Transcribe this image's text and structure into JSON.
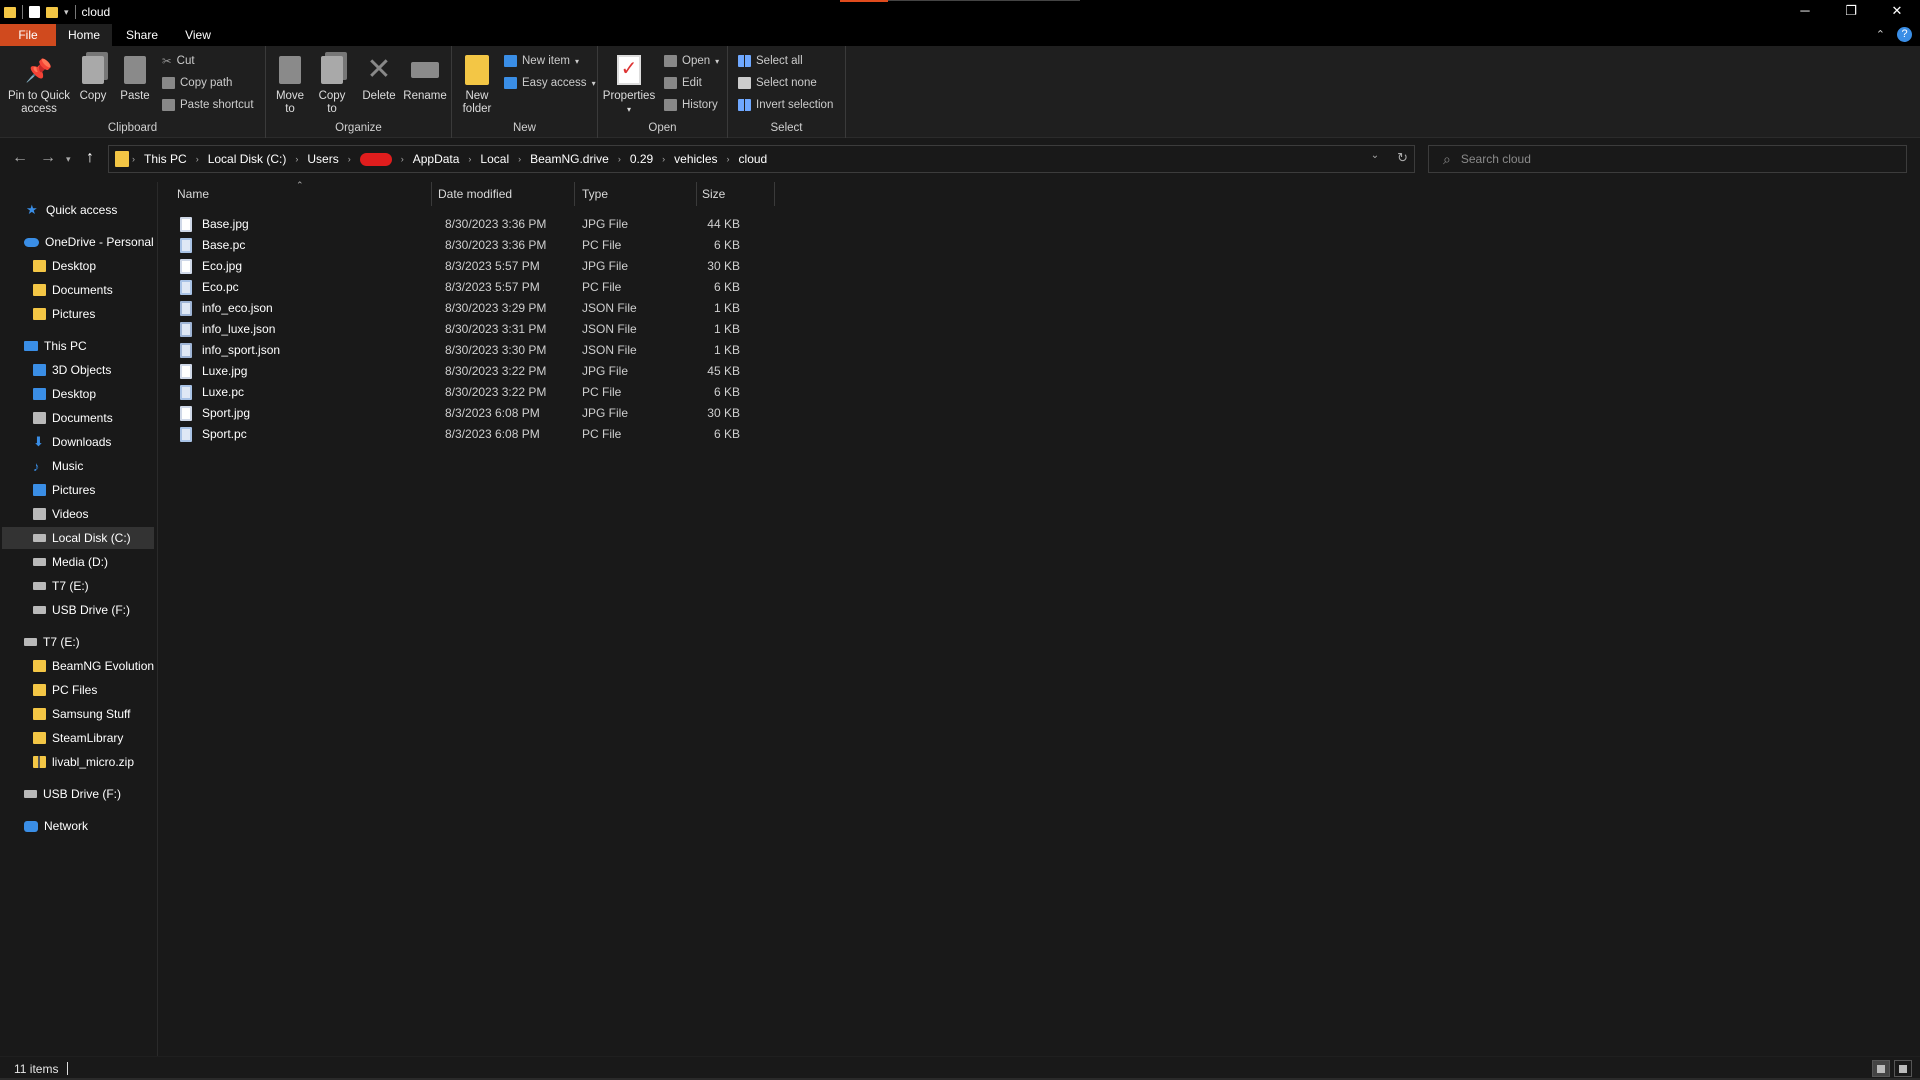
{
  "window": {
    "title": "cloud"
  },
  "tabs": {
    "file": "File",
    "home": "Home",
    "share": "Share",
    "view": "View"
  },
  "ribbon": {
    "clipboard": {
      "label": "Clipboard",
      "pin": "Pin to Quick",
      "pin2": "access",
      "copy": "Copy",
      "paste": "Paste",
      "cut": "Cut",
      "copy_path": "Copy path",
      "paste_shortcut": "Paste shortcut"
    },
    "organize": {
      "label": "Organize",
      "move": "Move",
      "move2": "to",
      "copy": "Copy",
      "copy2": "to",
      "delete": "Delete",
      "rename": "Rename"
    },
    "new": {
      "label": "New",
      "new_folder": "New",
      "new_folder2": "folder",
      "new_item": "New item",
      "easy_access": "Easy access"
    },
    "open": {
      "label": "Open",
      "properties": "Properties",
      "open": "Open",
      "edit": "Edit",
      "history": "History"
    },
    "select": {
      "label": "Select",
      "select_all": "Select all",
      "select_none": "Select none",
      "invert": "Invert selection"
    }
  },
  "address": {
    "crumbs": [
      "This PC",
      "Local Disk (C:)",
      "Users",
      "AppData",
      "Local",
      "BeamNG.drive",
      "0.29",
      "vehicles",
      "cloud"
    ]
  },
  "search": {
    "placeholder": "Search cloud"
  },
  "nav": {
    "quick_access": "Quick access",
    "onedrive": "OneDrive - Personal",
    "od_desktop": "Desktop",
    "od_documents": "Documents",
    "od_pictures": "Pictures",
    "this_pc": "This PC",
    "objects3d": "3D Objects",
    "desktop": "Desktop",
    "documents": "Documents",
    "downloads": "Downloads",
    "music": "Music",
    "pictures": "Pictures",
    "videos": "Videos",
    "local_c": "Local Disk (C:)",
    "media_d": "Media (D:)",
    "t7_e": "T7 (E:)",
    "usb_f": "USB Drive (F:)",
    "t7_root": "T7 (E:)",
    "beamng_evo": "BeamNG Evolution",
    "pc_files": "PC Files",
    "samsung": "Samsung Stuff",
    "steamlib": "SteamLibrary",
    "livabl": "livabl_micro.zip",
    "usb_root": "USB Drive (F:)",
    "network": "Network"
  },
  "columns": {
    "name": "Name",
    "date": "Date modified",
    "type": "Type",
    "size": "Size"
  },
  "files": [
    {
      "name": "Base.jpg",
      "date": "8/30/2023 3:36 PM",
      "type": "JPG File",
      "size": "44 KB",
      "kind": "jpg"
    },
    {
      "name": "Base.pc",
      "date": "8/30/2023 3:36 PM",
      "type": "PC File",
      "size": "6 KB",
      "kind": "pc"
    },
    {
      "name": "Eco.jpg",
      "date": "8/3/2023 5:57 PM",
      "type": "JPG File",
      "size": "30 KB",
      "kind": "jpg"
    },
    {
      "name": "Eco.pc",
      "date": "8/3/2023 5:57 PM",
      "type": "PC File",
      "size": "6 KB",
      "kind": "pc"
    },
    {
      "name": "info_eco.json",
      "date": "8/30/2023 3:29 PM",
      "type": "JSON File",
      "size": "1 KB",
      "kind": "json"
    },
    {
      "name": "info_luxe.json",
      "date": "8/30/2023 3:31 PM",
      "type": "JSON File",
      "size": "1 KB",
      "kind": "json"
    },
    {
      "name": "info_sport.json",
      "date": "8/30/2023 3:30 PM",
      "type": "JSON File",
      "size": "1 KB",
      "kind": "json"
    },
    {
      "name": "Luxe.jpg",
      "date": "8/30/2023 3:22 PM",
      "type": "JPG File",
      "size": "45 KB",
      "kind": "jpg"
    },
    {
      "name": "Luxe.pc",
      "date": "8/30/2023 3:22 PM",
      "type": "PC File",
      "size": "6 KB",
      "kind": "pc"
    },
    {
      "name": "Sport.jpg",
      "date": "8/3/2023 6:08 PM",
      "type": "JPG File",
      "size": "30 KB",
      "kind": "jpg"
    },
    {
      "name": "Sport.pc",
      "date": "8/3/2023 6:08 PM",
      "type": "PC File",
      "size": "6 KB",
      "kind": "pc"
    }
  ],
  "status": {
    "count": "11 items"
  },
  "colors": {
    "file_tab": "#d04a1e",
    "folder": "#f3c645",
    "accent": "#3a8ee6"
  }
}
